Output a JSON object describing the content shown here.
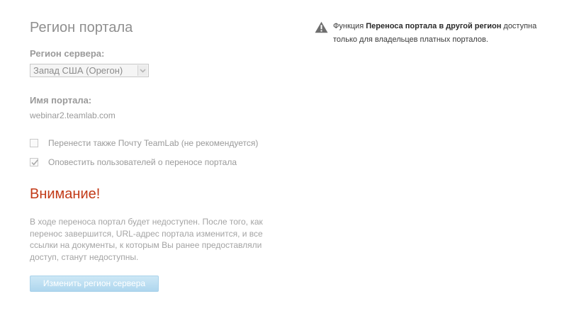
{
  "page": {
    "title": "Регион портала"
  },
  "server_region": {
    "label": "Регион сервера:",
    "selected": "Запад США (Орегон)"
  },
  "portal_name": {
    "label": "Имя портала:",
    "value": "webinar2.teamlab.com"
  },
  "options": [
    {
      "label": "Перенести также Почту TeamLab (не рекомендуется)",
      "checked": false
    },
    {
      "label": "Оповестить пользователей о переносе портала",
      "checked": true
    }
  ],
  "warning": {
    "title": "Внимание!",
    "text": "В ходе переноса портал будет недоступен. После того, как перенос завершится, URL-адрес портала изменится, и все ссылки на документы, к которым Вы ранее предоставляли доступ, станут недоступны."
  },
  "button": {
    "label": "Изменить регион сервера"
  },
  "info": {
    "text_before": "Функция ",
    "text_bold": "Переноса портала в другой регион",
    "text_after": " доступна только для владельцев платных порталов."
  },
  "colors": {
    "warning_title": "#c23a17",
    "button_bg": "#aed6ee",
    "muted_text": "#9a9a9a"
  },
  "icons": {
    "info": "warning-triangle-icon",
    "select": "chevron-down-icon",
    "checkbox": "checkmark-icon"
  }
}
